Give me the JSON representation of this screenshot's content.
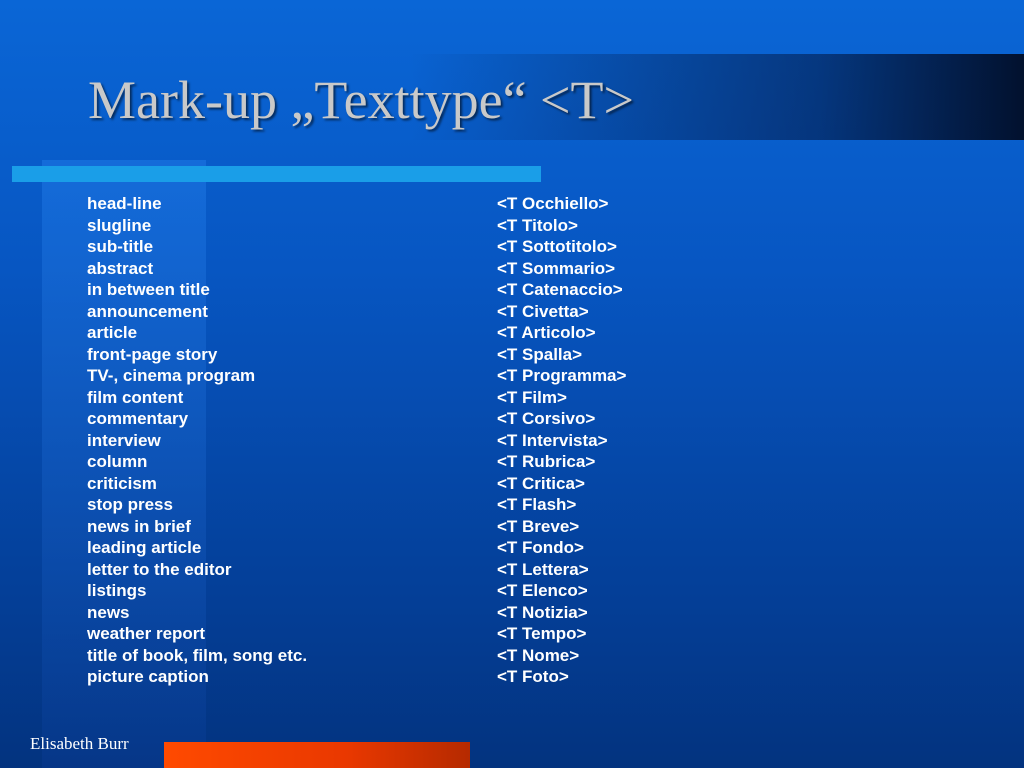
{
  "slide": {
    "title": "Mark-up „Texttype“ <T>",
    "author": "Elisabeth Burr"
  },
  "rows": [
    {
      "en": "head-line",
      "tag": "<T Occhiello>"
    },
    {
      "en": "slugline",
      "tag": "<T Titolo>"
    },
    {
      "en": "sub-title",
      "tag": "<T Sottotitolo>"
    },
    {
      "en": "abstract",
      "tag": "<T Sommario>"
    },
    {
      "en": "in between title",
      "tag": "<T Catenaccio>"
    },
    {
      "en": "announcement",
      "tag": "<T Civetta>"
    },
    {
      "en": "article",
      "tag": "<T Articolo>"
    },
    {
      "en": "front-page story",
      "tag": "<T Spalla>"
    },
    {
      "en": "TV-, cinema program",
      "tag": "<T Programma>"
    },
    {
      "en": "film content",
      "tag": "<T Film>"
    },
    {
      "en": "commentary",
      "tag": "<T Corsivo>"
    },
    {
      "en": "interview",
      "tag": "<T Intervista>"
    },
    {
      "en": "column",
      "tag": "<T Rubrica>"
    },
    {
      "en": "criticism",
      "tag": "<T Critica>"
    },
    {
      "en": "stop press",
      "tag": "<T Flash>"
    },
    {
      "en": "news in brief",
      "tag": "<T Breve>"
    },
    {
      "en": "leading article",
      "tag": "<T Fondo>"
    },
    {
      "en": "letter to the editor",
      "tag": "<T Lettera>"
    },
    {
      "en": "listings",
      "tag": "<T Elenco>"
    },
    {
      "en": "news",
      "tag": "<T Notizia>"
    },
    {
      "en": "weather report",
      "tag": "<T Tempo>"
    },
    {
      "en": "title of book, film, song etc.",
      "tag": "<T Nome>"
    },
    {
      "en": "picture caption",
      "tag": "<T Foto>"
    }
  ]
}
